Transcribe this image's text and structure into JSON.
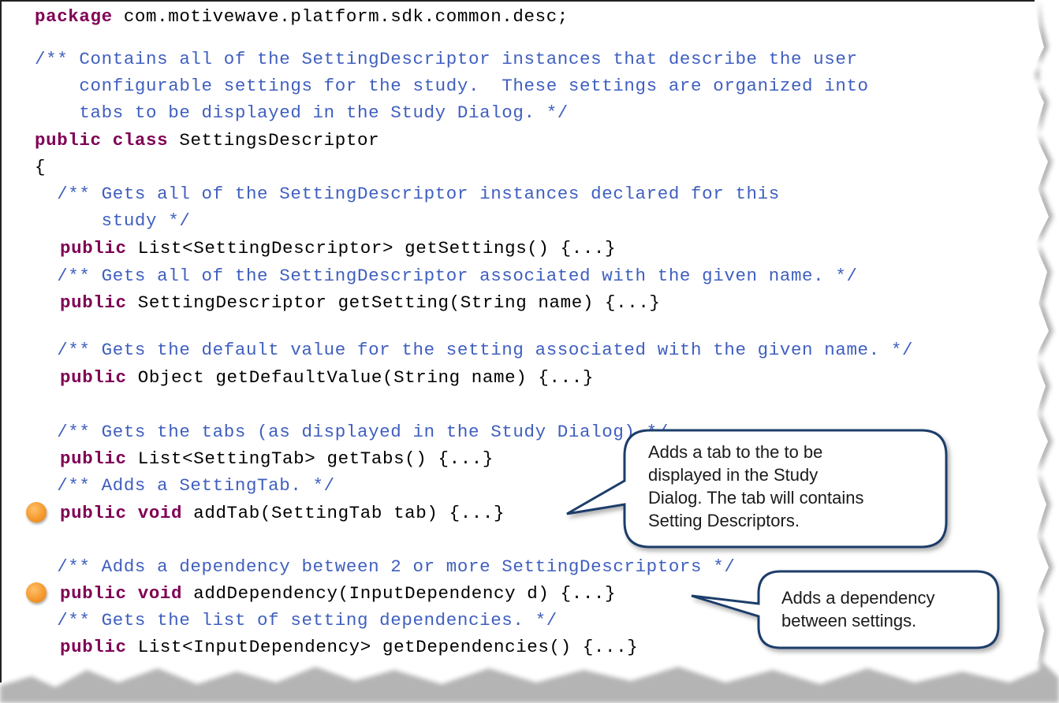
{
  "colors": {
    "keyword": "#7f0055",
    "comment": "#3f5fbf",
    "plain": "#000000",
    "marker": "#f59a2e",
    "callout_border": "#1f3d6b"
  },
  "code": {
    "package_kw": "package",
    "package_name": " com.motivewave.platform.sdk.common.desc;",
    "class_comment": [
      "/** Contains all of the SettingDescriptor instances that describe the user",
      "    configurable settings for the study.  These settings are organized into",
      "    tabs to be displayed in the Study Dialog. */"
    ],
    "class_decl_kw": "public class",
    "class_name": " SettingsDescriptor",
    "open_brace": "{",
    "m1_comment": [
      "  /** Gets all of the SettingDescriptor instances declared for this",
      "      study */"
    ],
    "m1_rest": " List<SettingDescriptor> getSettings() {...}",
    "m2_comment": "  /** Gets all of the SettingDescriptor associated with the given name. */",
    "m2_rest": " SettingDescriptor getSetting(String name) {...}",
    "m3_comment": "  /** Gets the default value for the setting associated with the given name. */",
    "m3_rest": " Object getDefaultValue(String name) {...}",
    "m4_comment": "  /** Gets the tabs (as displayed in the Study Dialog) */",
    "m4_rest": " List<SettingTab> getTabs() {...}",
    "m5_comment": "  /** Adds a SettingTab. */",
    "m5_rest": " addTab(SettingTab tab) {...}",
    "m6_comment": "  /** Adds a dependency between 2 or more SettingDescriptors */",
    "m6_rest": " addDependency(InputDependency d) {...}",
    "m7_comment": "  /** Gets the list of setting dependencies. */",
    "m7_rest": " List<InputDependency> getDependencies() {...}",
    "kw_public": "public",
    "kw_void": " void"
  },
  "callouts": {
    "add_tab": [
      "Adds a tab to the to be",
      "displayed in the Study",
      "Dialog.  The tab will contains",
      "Setting Descriptors."
    ],
    "add_dependency": [
      "Adds a dependency",
      "between settings."
    ]
  }
}
